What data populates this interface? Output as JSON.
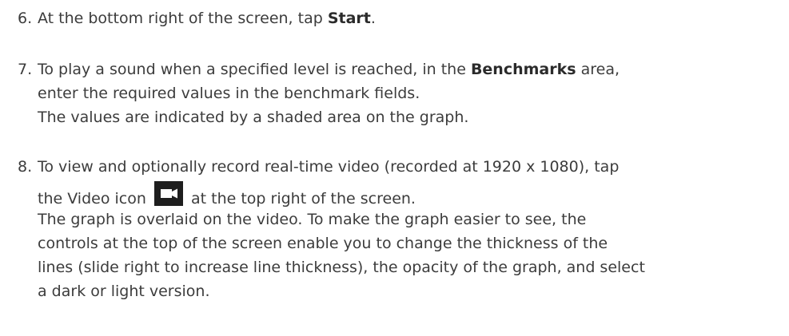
{
  "step6": {
    "num": "6.",
    "pre": "At the bottom right of the screen, tap ",
    "kw": "Start",
    "post": "."
  },
  "step7": {
    "num": "7.",
    "l1_pre": "To play a sound when a specified level is reached, in the ",
    "l1_kw": "Benchmarks",
    "l1_post": " area,",
    "l2": "enter the required values in the benchmark fields.",
    "l3": "The values are indicated by a shaded area on the graph."
  },
  "step8": {
    "num": "8.",
    "l1": "To view and optionally record real-time video (recorded at 1920 x 1080), tap",
    "l2_pre": "the Video icon",
    "l2_post": "at the top right of the screen.",
    "l3": "The graph is overlaid on the video. To make the graph easier to see, the",
    "l4": "controls at the top of the screen enable you to change the thickness of the",
    "l5": "lines (slide right to increase line thickness), the opacity of the graph, and select",
    "l6": "a dark or light version."
  },
  "icons": {
    "video": "video-camera-icon"
  },
  "colors": {
    "text": "#3c3c3c",
    "icon_bg": "#1e1e1e",
    "icon_fg": "#ffffff"
  }
}
